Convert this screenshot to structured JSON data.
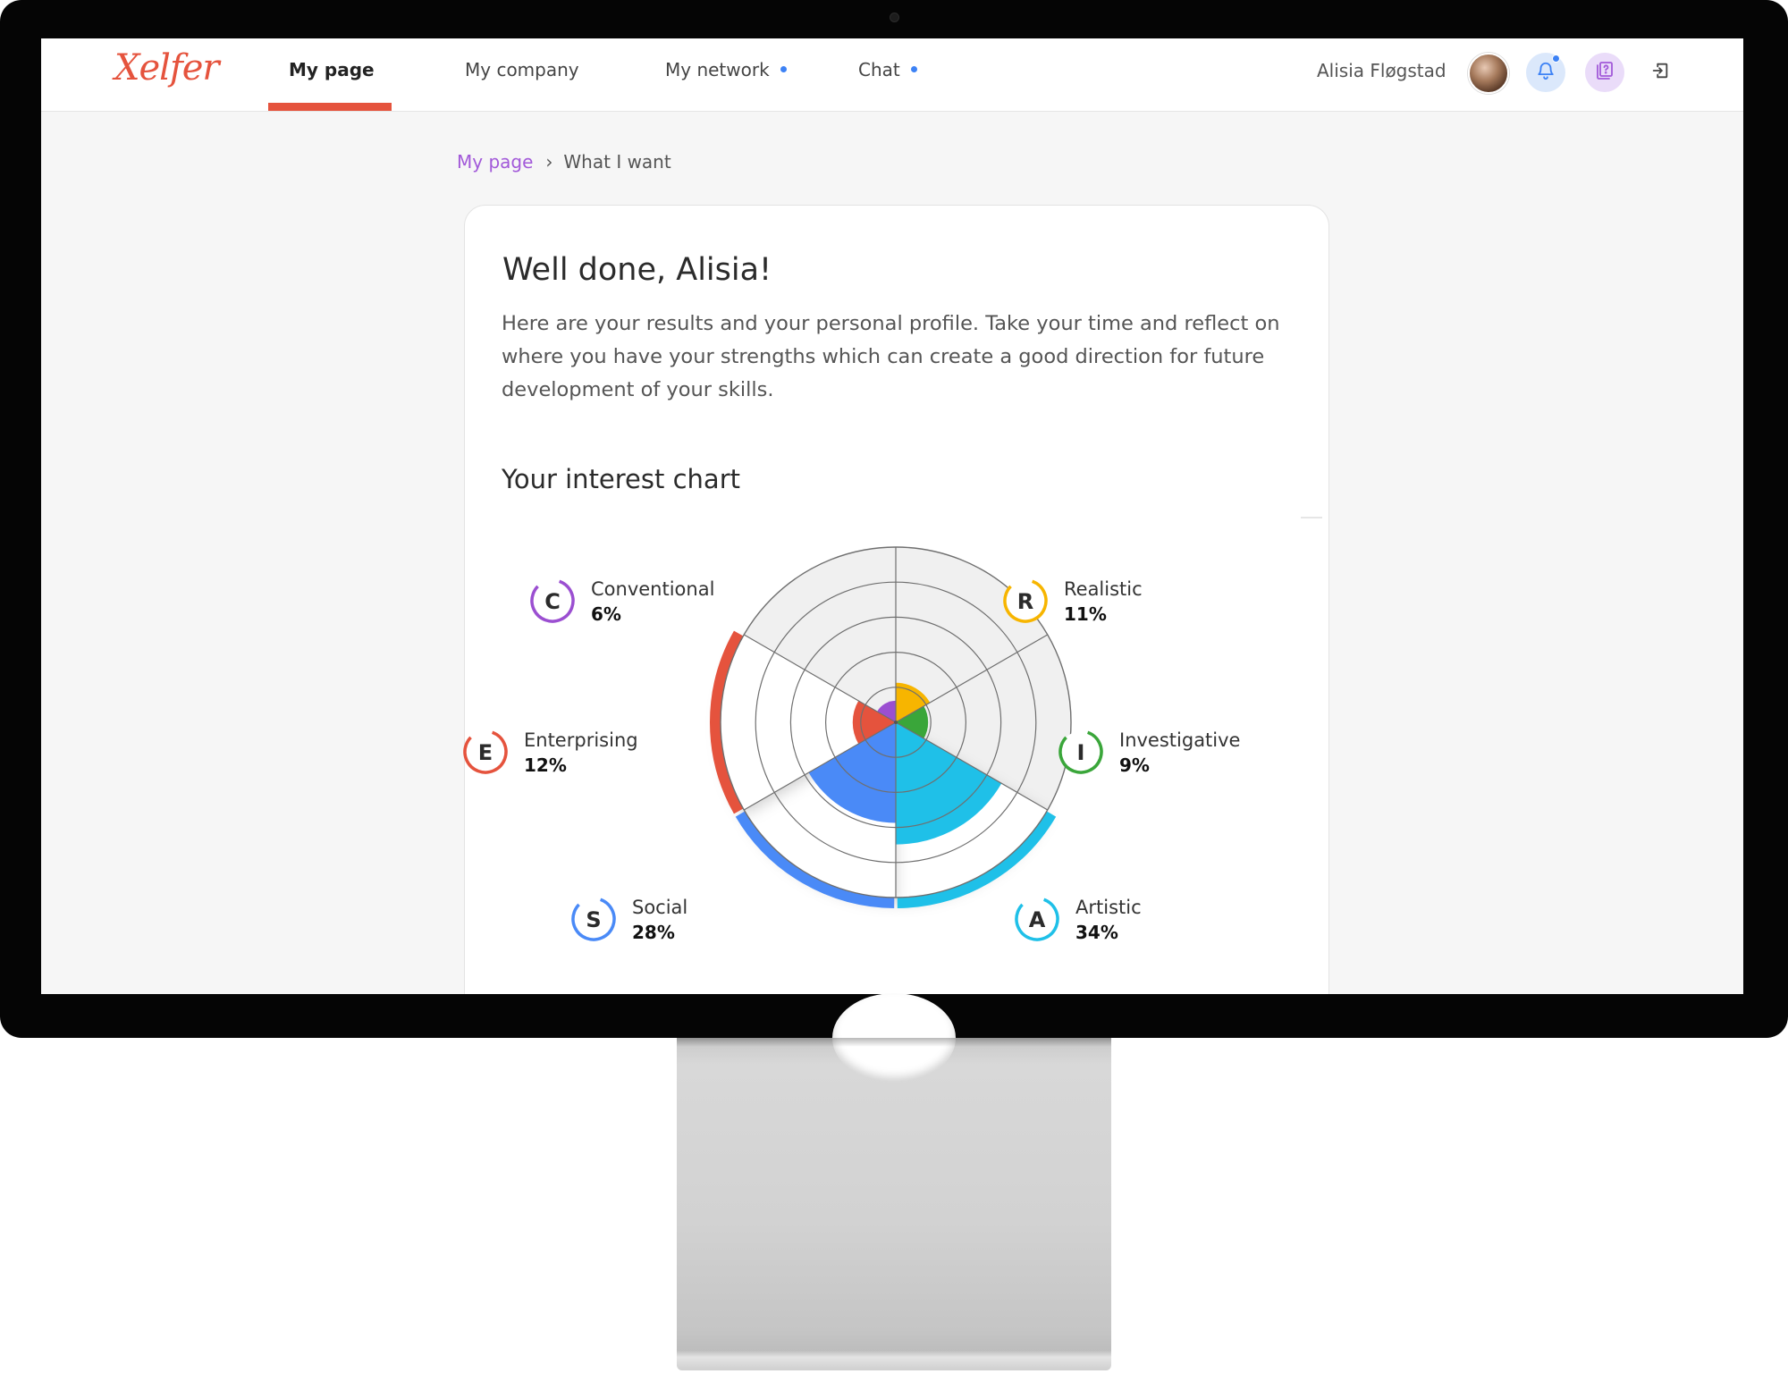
{
  "nav": {
    "logo": "Xelfer",
    "items": [
      {
        "label": "My page",
        "active": true,
        "dot": false
      },
      {
        "label": "My company",
        "active": false,
        "dot": false
      },
      {
        "label": "My network",
        "active": false,
        "dot": true
      },
      {
        "label": "Chat",
        "active": false,
        "dot": true
      }
    ],
    "user_name": "Alisia Fløgstad",
    "icons": {
      "bell": "bell-icon",
      "help": "help-book-icon",
      "logout": "logout-icon"
    },
    "accent_color": "#e5533d",
    "notification_dot_color": "#3d82f5"
  },
  "breadcrumb": {
    "parent": "My page",
    "separator": "›",
    "current": "What I want",
    "link_color": "#a259d9"
  },
  "card": {
    "title": "Well done, Alisia!",
    "intro": "Here are your results and your personal profile. Take your time and reflect on where you have your strengths which can create a good direction for future development of your skills.",
    "chart_heading": "Your interest chart"
  },
  "chart_data": {
    "type": "pie",
    "variant": "polar-area (RIASEC interest profile)",
    "rings": 5,
    "categories": [
      "Realistic",
      "Investigative",
      "Artistic",
      "Social",
      "Enterprising",
      "Conventional"
    ],
    "letters": [
      "R",
      "I",
      "A",
      "S",
      "E",
      "C"
    ],
    "values": [
      11,
      9,
      34,
      28,
      12,
      6
    ],
    "value_suffix": "%",
    "colors": [
      "#f7b500",
      "#3aa63a",
      "#1fc0e8",
      "#4a8af7",
      "#e5533d",
      "#9b4fd1"
    ],
    "labels": {
      "R": {
        "name": "Realistic",
        "pct": "11%"
      },
      "I": {
        "name": "Investigative",
        "pct": "9%"
      },
      "A": {
        "name": "Artistic",
        "pct": "34%"
      },
      "S": {
        "name": "Social",
        "pct": "28%"
      },
      "E": {
        "name": "Enterprising",
        "pct": "12%"
      },
      "C": {
        "name": "Conventional",
        "pct": "6%"
      }
    },
    "outer_arcs": [
      "Artistic",
      "Social",
      "Enterprising"
    ]
  }
}
